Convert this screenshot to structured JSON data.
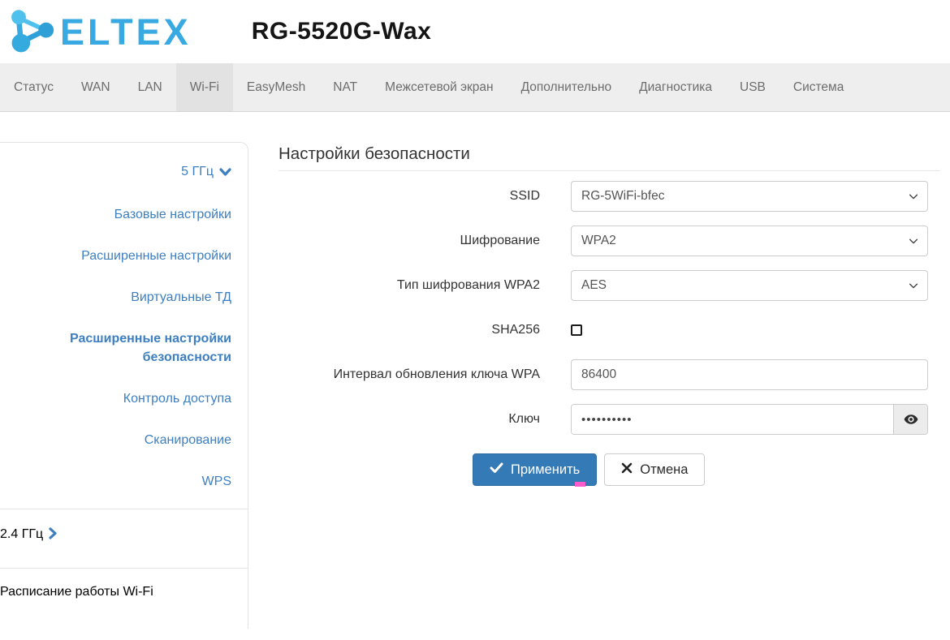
{
  "header": {
    "brand": "ELTEX",
    "model": "RG-5520G-Wax"
  },
  "nav": {
    "active": "Wi-Fi",
    "tabs": [
      "Статус",
      "WAN",
      "LAN",
      "Wi-Fi",
      "EasyMesh",
      "NAT",
      "Межсетевой экран",
      "Дополнительно",
      "Диагностика",
      "USB",
      "Система"
    ]
  },
  "sidebar": {
    "band5_label": "5 ГГц",
    "items5": [
      "Базовые настройки",
      "Расширенные настройки",
      "Виртуальные ТД",
      "Расширенные настройки безопасности",
      "Контроль доступа",
      "Сканирование",
      "WPS"
    ],
    "active_item": "Расширенные настройки безопасности",
    "band24_label": "2.4 ГГц",
    "schedule_label": "Расписание работы Wi-Fi"
  },
  "main": {
    "title": "Настройки безопасности",
    "form": {
      "ssid": {
        "label": "SSID",
        "value": "RG-5WiFi-bfec"
      },
      "encryption": {
        "label": "Шифрование",
        "value": "WPA2"
      },
      "wpa2_cipher": {
        "label": "Тип шифрования WPA2",
        "value": "AES"
      },
      "sha256": {
        "label": "SHA256",
        "checked": false
      },
      "rekey_interval": {
        "label": "Интервал обновления ключа WPA",
        "value": "86400"
      },
      "key": {
        "label": "Ключ",
        "value": "••••••••••"
      }
    },
    "actions": {
      "apply": "Применить",
      "cancel": "Отмена"
    }
  },
  "colors": {
    "accent_blue": "#337ab7",
    "link_blue": "#3d7fc0",
    "brand_blue": "#38a9e1",
    "nav_bg": "#eeeeee",
    "nav_active_bg": "#e2e2e2",
    "marker_pink": "#fa5ccb"
  }
}
